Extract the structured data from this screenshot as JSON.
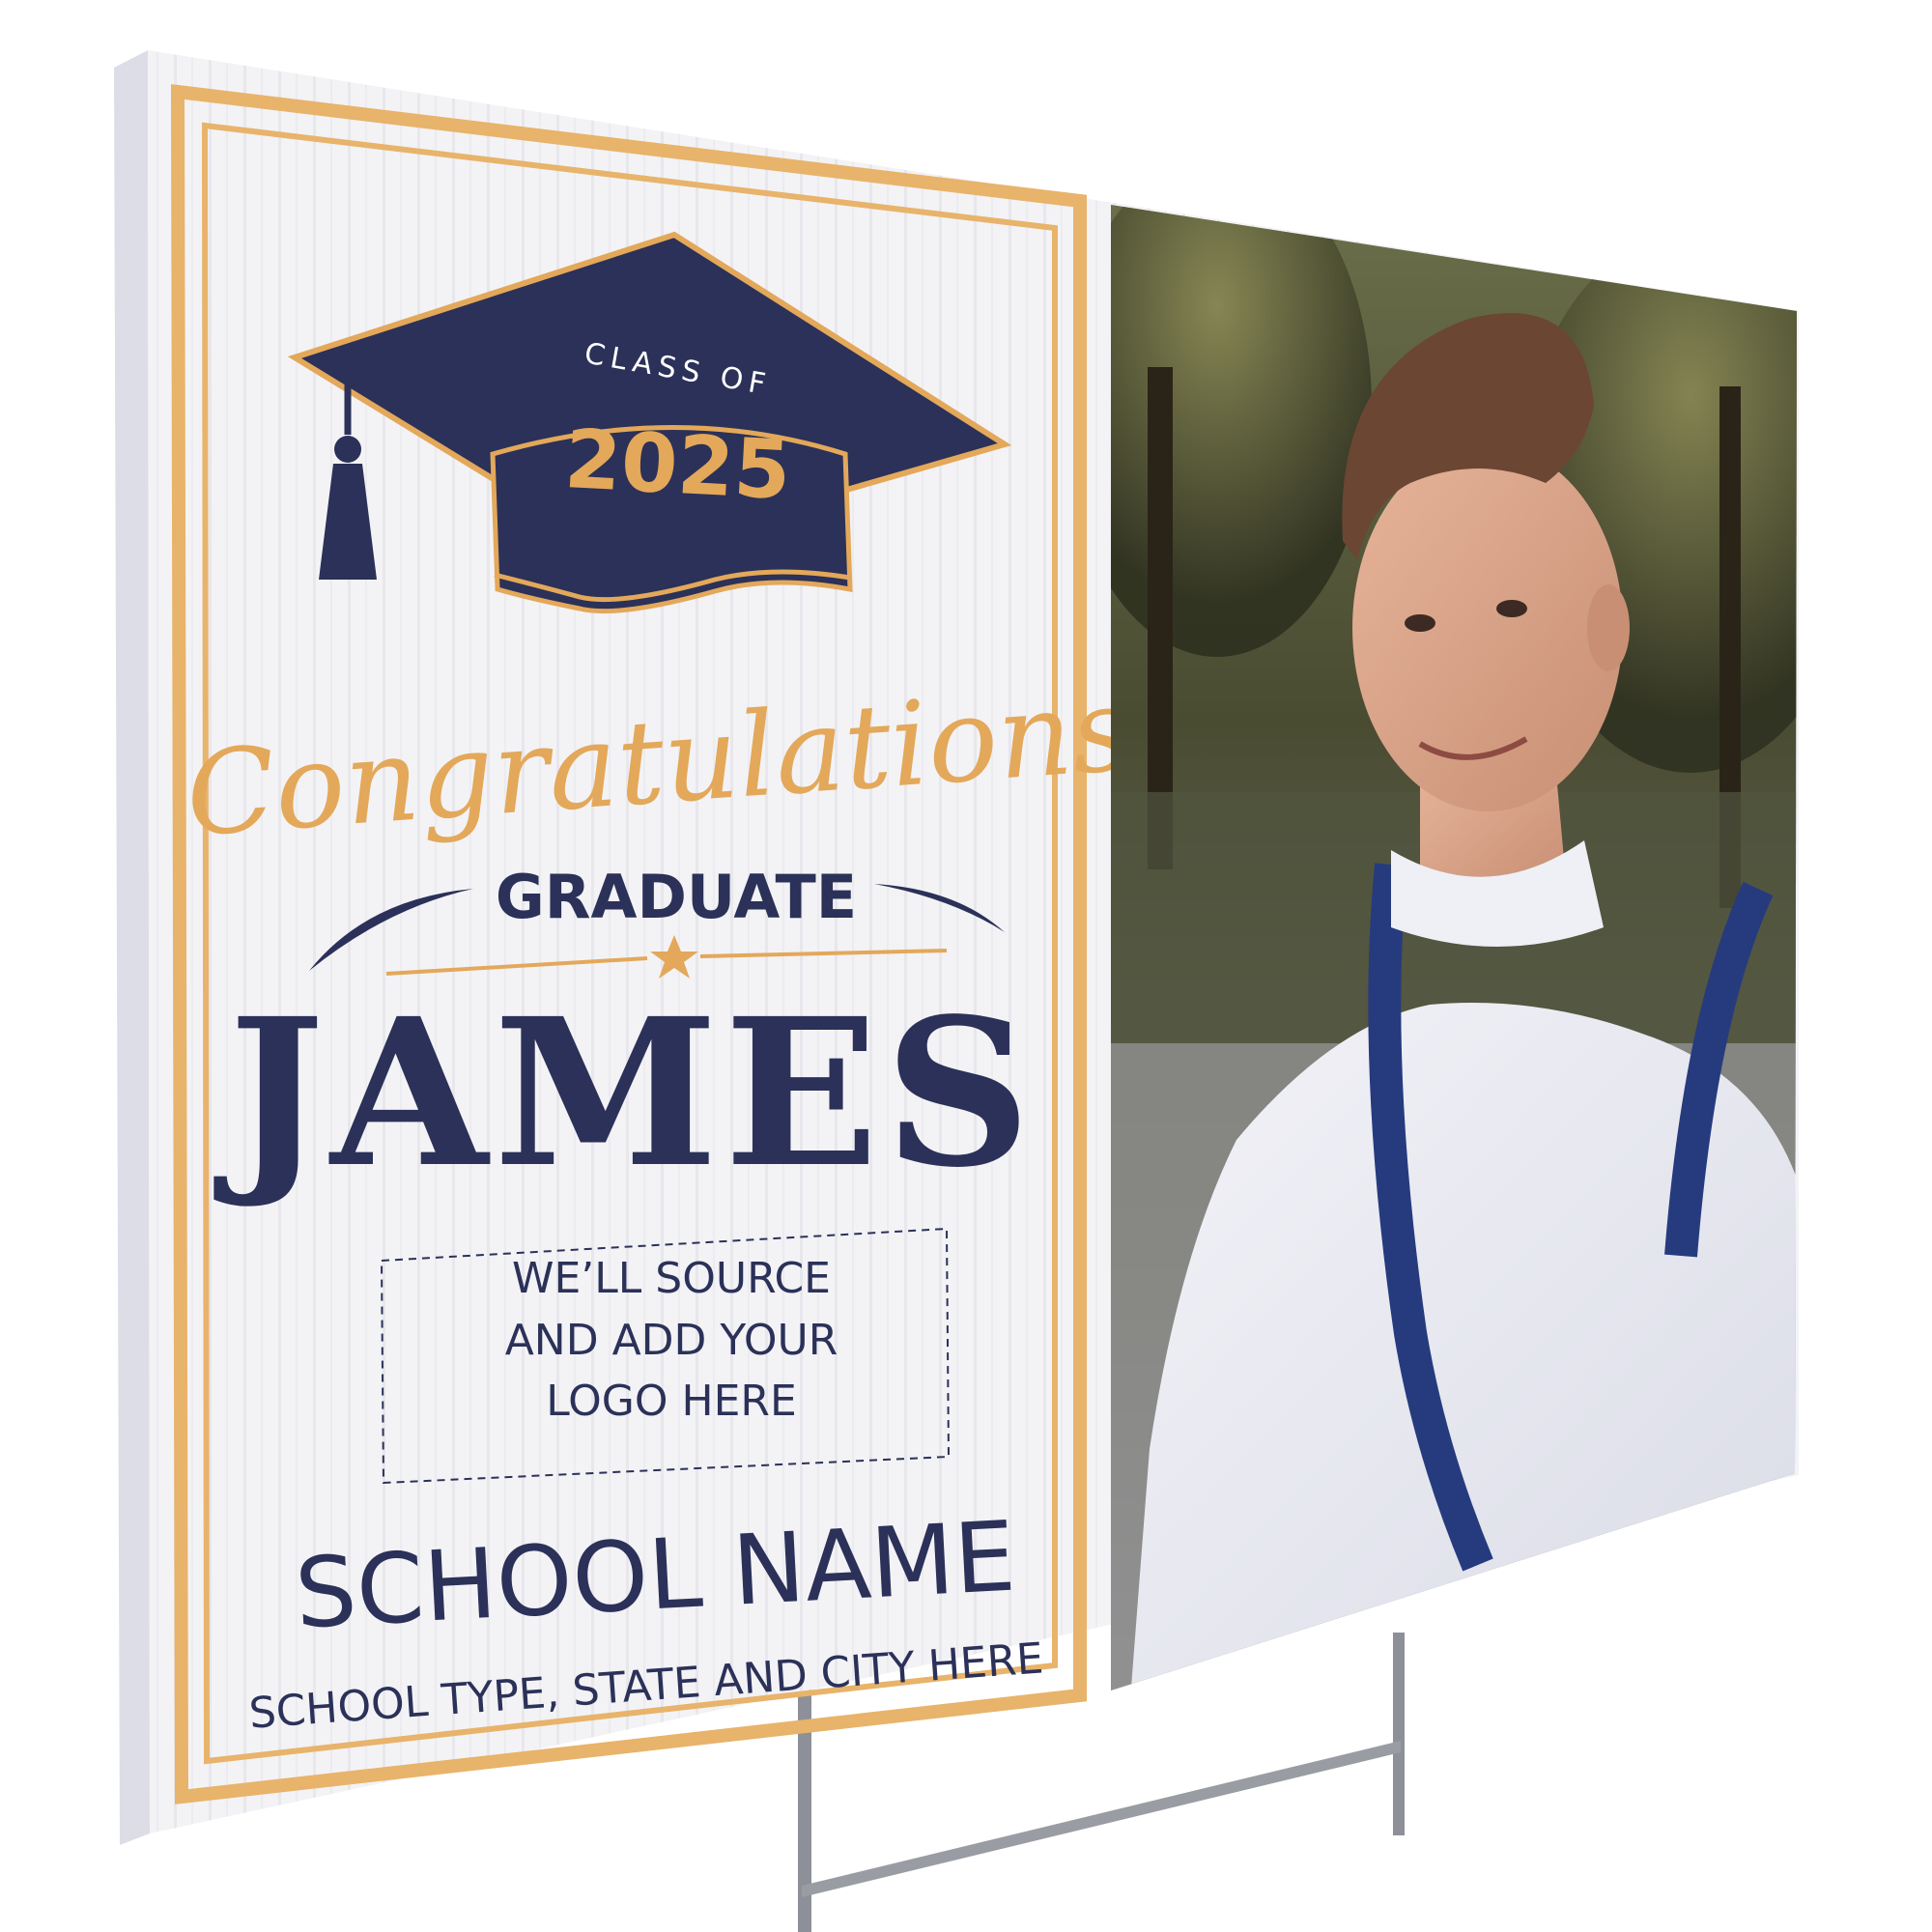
{
  "sign": {
    "cap_label_top": "CLASS OF",
    "cap_year": "2025",
    "congrats_script": "Congratulations",
    "graduate_label": "GRADUATE",
    "student_name": "JAMES",
    "logo_placeholder": {
      "line1": "WE’LL SOURCE",
      "line2": "AND ADD YOUR",
      "line3": "LOGO HERE"
    },
    "school_name": "SCHOOL NAME",
    "school_details": "SCHOOL TYPE, STATE AND CITY HERE"
  },
  "colors": {
    "navy": "#2b3158",
    "gold": "#e3a85a",
    "board": "#f4f4f6",
    "frame_outer": "#e8b36a"
  },
  "photo": {
    "subject": "portrait-of-smiling-young-man-with-suspenders",
    "background": "park-trees"
  }
}
